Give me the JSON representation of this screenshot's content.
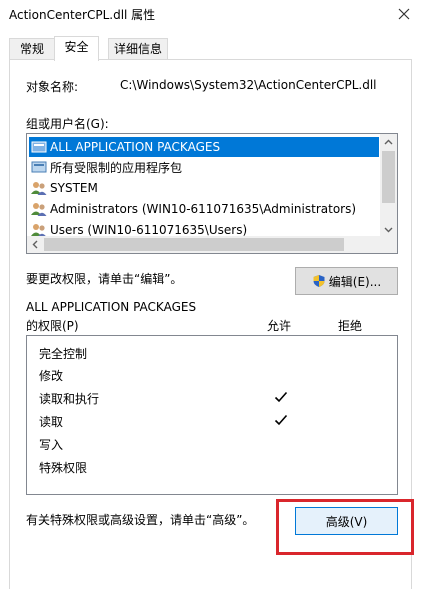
{
  "window": {
    "title": "ActionCenterCPL.dll 属性"
  },
  "tabs": [
    {
      "label": "常规"
    },
    {
      "label": "安全"
    },
    {
      "label": "详细信息"
    }
  ],
  "object": {
    "label": "对象名称:",
    "value": "C:\\Windows\\System32\\ActionCenterCPL.dll"
  },
  "groups": {
    "label": "组或用户名(G):",
    "items": [
      {
        "name": "ALL APPLICATION PACKAGES",
        "icon": "package-icon"
      },
      {
        "name": "所有受限制的应用程序包",
        "icon": "package-icon"
      },
      {
        "name": "SYSTEM",
        "icon": "users-icon"
      },
      {
        "name": "Administrators (WIN10-611071635\\Administrators)",
        "icon": "users-icon"
      },
      {
        "name": "Users (WIN10-611071635\\Users)",
        "icon": "users-icon"
      }
    ],
    "selected_index": 0
  },
  "edit": {
    "hint": "要更改权限，请单击“编辑”。",
    "button_label": "编辑(E)..."
  },
  "permissions": {
    "for_label": "ALL APPLICATION PACKAGES",
    "label": "的权限(P)",
    "allow_header": "允许",
    "deny_header": "拒绝",
    "items": [
      {
        "name": "完全控制",
        "allow": false,
        "deny": false
      },
      {
        "name": "修改",
        "allow": false,
        "deny": false
      },
      {
        "name": "读取和执行",
        "allow": true,
        "deny": false
      },
      {
        "name": "读取",
        "allow": true,
        "deny": false
      },
      {
        "name": "写入",
        "allow": false,
        "deny": false
      },
      {
        "name": "特殊权限",
        "allow": false,
        "deny": false
      }
    ]
  },
  "advanced": {
    "hint": "有关特殊权限或高级设置，请单击“高级”。",
    "button_label": "高级(V)"
  },
  "colors": {
    "selection": "#0078d7",
    "highlight_box": "#d9262c"
  }
}
